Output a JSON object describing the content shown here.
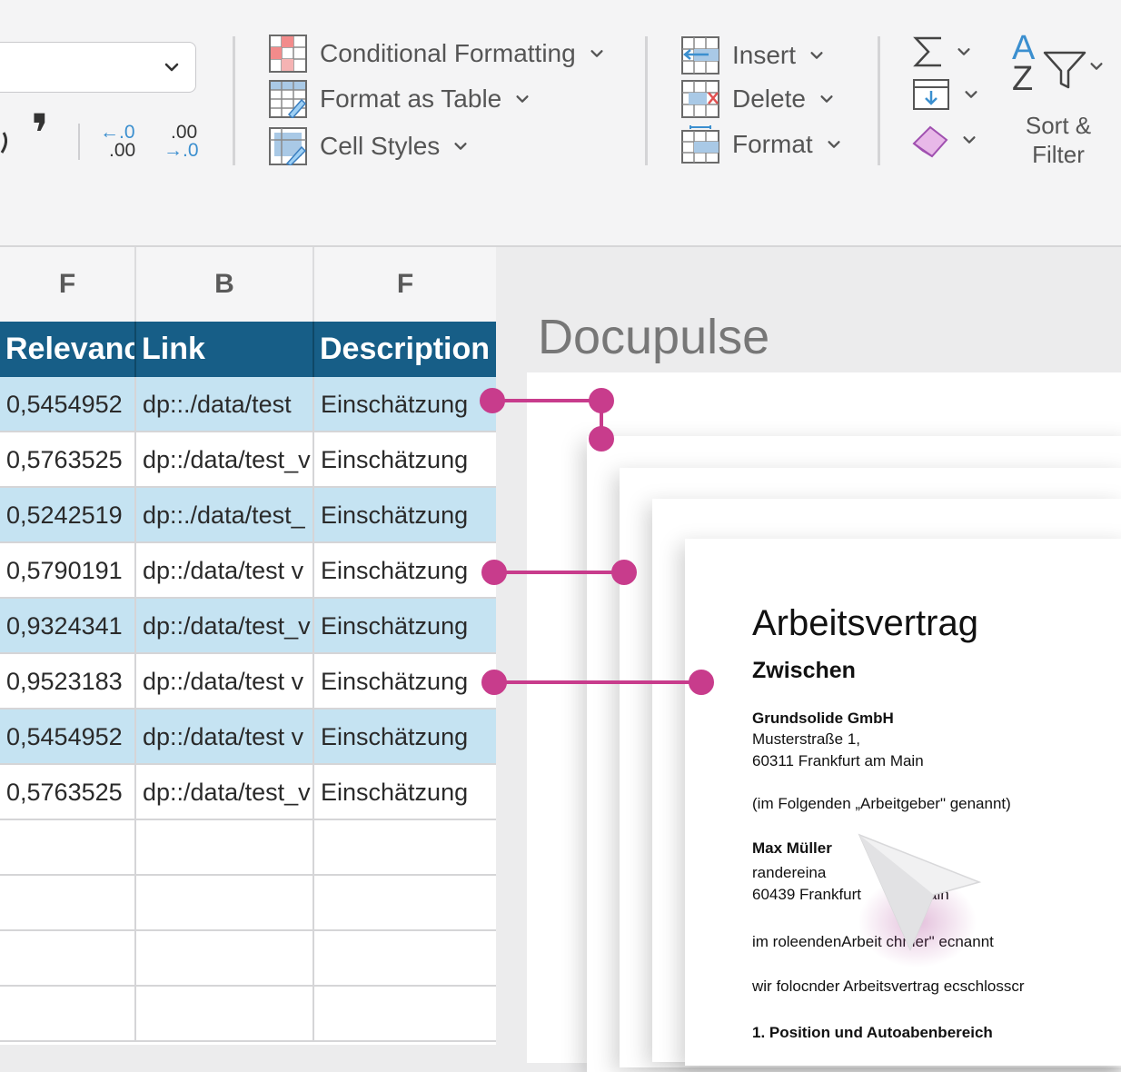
{
  "ribbon": {
    "number_format": {
      "comma_glyph": "❜",
      "decrease_decimal": {
        "top": "←.0",
        "bottom": ".00"
      },
      "increase_decimal": {
        "top": ".00",
        "bottom": "→.0"
      }
    },
    "styles": {
      "conditional_formatting": "Conditional Formatting",
      "format_as_table": "Format as Table",
      "cell_styles": "Cell Styles"
    },
    "cells": {
      "insert": "Insert",
      "delete": "Delete",
      "format": "Format"
    },
    "editing": {
      "sort_filter_line1": "Sort &",
      "sort_filter_line2": "Filter",
      "az_top": "A",
      "az_bottom": "Z"
    }
  },
  "sheet": {
    "column_letters": [
      "F",
      "B",
      "F"
    ],
    "headers": [
      "Relevance",
      "Link",
      "Description"
    ],
    "rows": [
      {
        "relevance": "0,5454952",
        "link": "dp::./data/test ",
        "description": "Einschätzung",
        "highlight": true
      },
      {
        "relevance": "0,5763525",
        "link": "dp::/data/test_v",
        "description": "Einschätzung",
        "highlight": false
      },
      {
        "relevance": "0,5242519",
        "link": "dp::./data/test_",
        "description": "Einschätzung",
        "highlight": true
      },
      {
        "relevance": "0,5790191",
        "link": "dp::/data/test v",
        "description": "Einschätzung",
        "highlight": false
      },
      {
        "relevance": "0,9324341",
        "link": "dp::/data/test_v",
        "description": "Einschätzung",
        "highlight": true
      },
      {
        "relevance": "0,9523183",
        "link": "dp::/data/test v",
        "description": "Einschätzung",
        "highlight": false
      },
      {
        "relevance": "0,5454952",
        "link": "dp::/data/test v",
        "description": "Einschätzung",
        "highlight": true
      },
      {
        "relevance": "0,5763525",
        "link": "dp::/data/test_v",
        "description": "Einschätzung",
        "highlight": false
      }
    ]
  },
  "document": {
    "app_title": "Docupulse",
    "title": "Arbeitsvertrag",
    "subtitle": "Zwischen",
    "employer_name": "Grundsolide GmbH",
    "employer_street": "Musterstraße 1,",
    "employer_city": " 60311 Frankfurt am Main",
    "employer_note": "(im Folgenden „Arbeitgeber\" genannt)",
    "employee_name": "Max Müller",
    "employee_street": "randereina",
    "employee_city": "60439 Frankfurt",
    "employee_city_tail": "ain",
    "employee_note": "im roleendenArbeit  chmer\" ecnannt",
    "agreement": "wir folocnder Arbeitsvertrag ecschlosscr",
    "section_1": "1. Position und Autoabenbereich"
  },
  "colors": {
    "header_blue": "#175e87",
    "row_highlight": "#c5e3f2",
    "connector_magenta": "#c83c8c"
  },
  "icons": {
    "conditional_formatting": "conditional-formatting-icon",
    "format_as_table": "format-as-table-icon",
    "cell_styles": "cell-styles-icon",
    "insert": "insert-cells-icon",
    "delete": "delete-cells-icon",
    "format": "format-cells-icon",
    "autosum": "sigma-icon",
    "fill": "fill-down-icon",
    "clear": "eraser-icon",
    "sort_filter": "sort-filter-icon",
    "cursor": "pointer-cursor-icon"
  }
}
